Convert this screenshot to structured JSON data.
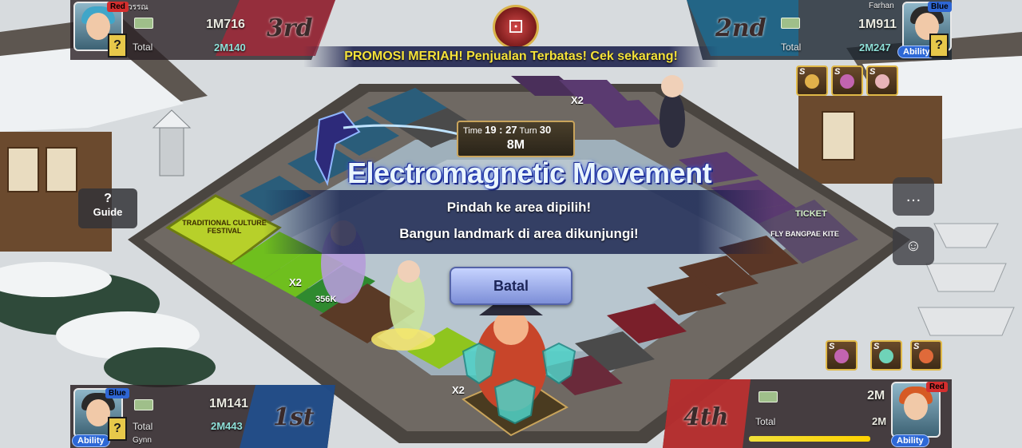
{
  "promo_banner": "PROMOSI MERIAH! Penjualan Terbatas! Cek sekarang!",
  "timer": {
    "time_label": "Time",
    "time_value": "19 : 27",
    "turn_label": "Turn",
    "turn_value": "30",
    "bet": "8M"
  },
  "skill": {
    "title": "Electromagnetic Movement",
    "line1": "Pindah ke area dipilih!",
    "line2": "Bangun landmark di area dikunjungi!",
    "cancel_label": "Batal"
  },
  "guide": {
    "icon": "?",
    "label": "Guide"
  },
  "players": {
    "top_left": {
      "name": "วรรณ",
      "team": "Red",
      "cash": "1M716",
      "total_label": "Total",
      "total": "2M140",
      "rank": "3rd"
    },
    "top_right": {
      "name": "Farhan",
      "team": "Blue",
      "cash": "1M911",
      "total_label": "Total",
      "total": "2M247",
      "rank": "2nd",
      "ability": "Ability"
    },
    "bottom_left": {
      "name": "Gynn",
      "team": "Blue",
      "cash": "1M141",
      "total_label": "Total",
      "total": "2M443",
      "rank": "1st",
      "ability": "Ability"
    },
    "bottom_right": {
      "name": "",
      "team": "Red",
      "cash": "2M",
      "total_label": "Total",
      "total": "2M",
      "rank": "4th",
      "ability": "Ability"
    }
  },
  "board": {
    "festival_label": "TRADITIONAL CULTURE FESTIVAL",
    "tile_x2_left": "X2",
    "tile_price": "356K",
    "tile_x2_bottom": "X2",
    "tile_x2_top": "X2",
    "tile_ticket": "TICKET",
    "tile_fireworks": "FLY BANGPAE KITE"
  },
  "colors": {
    "promo_text": "#f5e23a",
    "team_red": "#d42e2e",
    "team_blue": "#2e66d4"
  }
}
